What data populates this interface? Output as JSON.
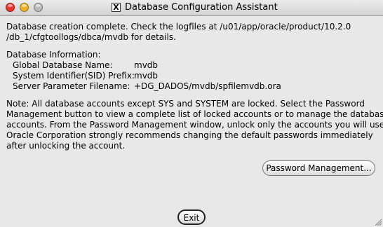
{
  "window": {
    "title": "Database Configuration Assistant",
    "app_icon": "X"
  },
  "message": {
    "line1": "Database creation complete. Check the logfiles at /u01/app/oracle/product/10.2.0",
    "line2": "/db_1/cfgtoollogs/dbca/mvdb for details."
  },
  "info": {
    "heading": "Database Information:",
    "rows": [
      {
        "label": "Global Database Name:",
        "value": "mvdb"
      },
      {
        "label": "System Identifier(SID) Prefix:",
        "value": "mvdb"
      },
      {
        "label": "Server Parameter Filename:",
        "value": "+DG_DADOS/mvdb/spfilemvdb.ora"
      }
    ]
  },
  "note": {
    "lines": [
      "Note: All database accounts except SYS and SYSTEM are locked. Select the Password",
      "Management button to view a complete list of locked accounts or to manage the database",
      "accounts. From the Password Management window, unlock only the accounts you will use.",
      "Oracle Corporation strongly recommends changing the default passwords immediately",
      "after unlocking the account."
    ]
  },
  "buttons": {
    "password_management": "Password Management...",
    "exit": "Exit"
  },
  "icons": {
    "close": "close-icon",
    "minimize": "minimize-icon",
    "zoom": "zoom-icon",
    "resize": "resize-grip-icon"
  },
  "colors": {
    "close": "#e8352f",
    "minimize": "#e8b12c",
    "zoom": "#b9b9b9",
    "background": "#e8e8e8"
  }
}
